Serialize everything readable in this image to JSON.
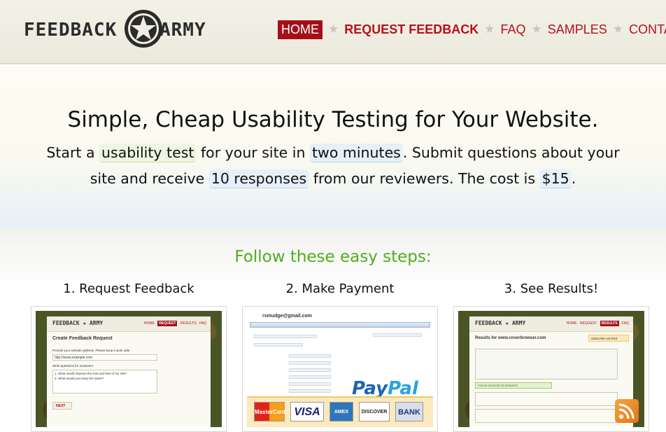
{
  "logo": {
    "left": "FEEDBACK",
    "right": "ARMY"
  },
  "nav": {
    "home": "HOME",
    "request": "REQUEST FEEDBACK",
    "faq": "FAQ",
    "samples": "SAMPLES",
    "contact": "CONTACT",
    "separator": "★"
  },
  "hero": {
    "title": "Simple, Cheap Usability Testing for Your Website.",
    "line1_a": "Start a ",
    "line1_hl1": "usability test",
    "line1_b": " for your site in ",
    "line1_hl2": "two minutes",
    "line1_c": ". Submit questions about your",
    "line2_a": "site and receive ",
    "line2_hl1": "10 responses",
    "line2_b": " from our reviewers. The cost is ",
    "line2_hl2": "$15",
    "line2_c": "."
  },
  "steps": {
    "heading": "Follow these easy steps:",
    "items": [
      {
        "title": "1. Request Feedback"
      },
      {
        "title": "2. Make Payment"
      },
      {
        "title": "3. See Results!"
      }
    ]
  },
  "thumb1": {
    "logo": "FEEDBACK ★ ARMY",
    "page_title": "Create Feedback Request",
    "field1_label": "Provide your website address. Please keep it work safe.",
    "field1_value": "http://www.example.com",
    "field2_label": "Write questions for reviewers",
    "q1": "1. What would improve the look and feel of my site?",
    "q2": "2. What would you keep the same?",
    "submit": "NEXT"
  },
  "thumb2": {
    "email": "rsmudge@gmail.com",
    "paypal_a": "Pay",
    "paypal_b": "Pal",
    "cards": [
      "MasterCard",
      "VISA",
      "AMEX",
      "DISCOVER",
      "BANK"
    ]
  },
  "thumb3": {
    "logo": "FEEDBACK ★ ARMY",
    "results_title": "Results for www.coverbrowser.com",
    "subscribe": "Subscribe via RSS",
    "badge": "You've received 10 answers!"
  }
}
